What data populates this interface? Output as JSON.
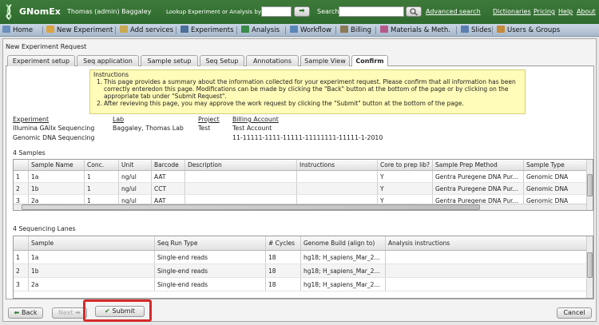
{
  "topbar": {
    "brand": "GNomEx",
    "user": "Thomas (admin) Baggaley",
    "lookup_label": "Lookup Experiment or Analysis by #",
    "go_label": "➡",
    "search_label": "Search",
    "advanced_search": "Advanced search",
    "links": [
      "Dictionaries",
      "Pricing",
      "Help",
      "About"
    ]
  },
  "nav": {
    "items": [
      "Home",
      "New Experiment",
      "Add services",
      "Experiments",
      "Analysis",
      "Workflow",
      "Billing",
      "Materials & Meth.",
      "Slides",
      "Users & Groups"
    ]
  },
  "window": {
    "title": "New Experiment Request",
    "tabs": [
      "Experiment setup",
      "Seq application",
      "Sample setup",
      "Seq Setup",
      "Annotations",
      "Sample View",
      "Confirm"
    ],
    "active_tab": "Confirm"
  },
  "instructions": {
    "title": "Instructions",
    "items": [
      {
        "n": "1.",
        "text": "This page provides a summary about the information collected for your experiment request.  Please confirm that all information has been correctly enteredon this page. Modifications can be made by clicking the \"Back\" button at the bottom of the page or by clicking on the appropriate tab under \"Submit Request\"."
      },
      {
        "n": "2.",
        "text": "After revieving this page, you may approve the work request by clicking the \"Submit\" button at the bottom of the page."
      }
    ]
  },
  "summary": {
    "headers": {
      "experiment": "Experiment",
      "lab": "Lab",
      "project": "Project",
      "billing": "Billing Account"
    },
    "experiment_lines": [
      "Illumina GAIIx Sequencing",
      "Genomic DNA Sequencing"
    ],
    "lab": "Baggaley, Thomas Lab",
    "project": "Test",
    "billing_lines": [
      "Test Account",
      "11-11111-1111-11111-11111111-11111-1-2010"
    ]
  },
  "samples": {
    "label": "4 Samples",
    "columns": [
      "",
      "Sample Name",
      "Conc.",
      "Unit",
      "Barcode",
      "Description",
      "Instructions",
      "Core to prep lib?",
      "Sample Prep Method",
      "Sample Type"
    ],
    "rows": [
      [
        "1",
        "1a",
        "1",
        "ng/ul",
        "AAT",
        "",
        "",
        "Y",
        "Gentra Puregene DNA Pur...",
        "Genomic DNA"
      ],
      [
        "2",
        "1b",
        "1",
        "ng/ul",
        "CCT",
        "",
        "",
        "Y",
        "Gentra Puregene DNA Pur...",
        "Genomic DNA"
      ],
      [
        "3",
        "2a",
        "1",
        "ng/ul",
        "AAT",
        "",
        "",
        "Y",
        "Gentra Puregene DNA Pur...",
        "Genomic DNA"
      ]
    ]
  },
  "lanes": {
    "label": "4 Sequencing Lanes",
    "columns": [
      "",
      "Sample",
      "Seq Run Type",
      "# Cycles",
      "Genome Build (align to)",
      "Analysis instructions"
    ],
    "rows": [
      [
        "1",
        "1a",
        "Single-end reads",
        "18",
        "hg18; H_sapiens_Mar_2...",
        ""
      ],
      [
        "2",
        "1b",
        "Single-end reads",
        "18",
        "hg18; H_sapiens_Mar_2...",
        ""
      ],
      [
        "3",
        "2a",
        "Single-end reads",
        "18",
        "hg18; H_sapiens_Mar_2...",
        ""
      ]
    ]
  },
  "buttons": {
    "back": "Back",
    "next": "Next",
    "submit": "Submit",
    "cancel": "Cancel"
  }
}
